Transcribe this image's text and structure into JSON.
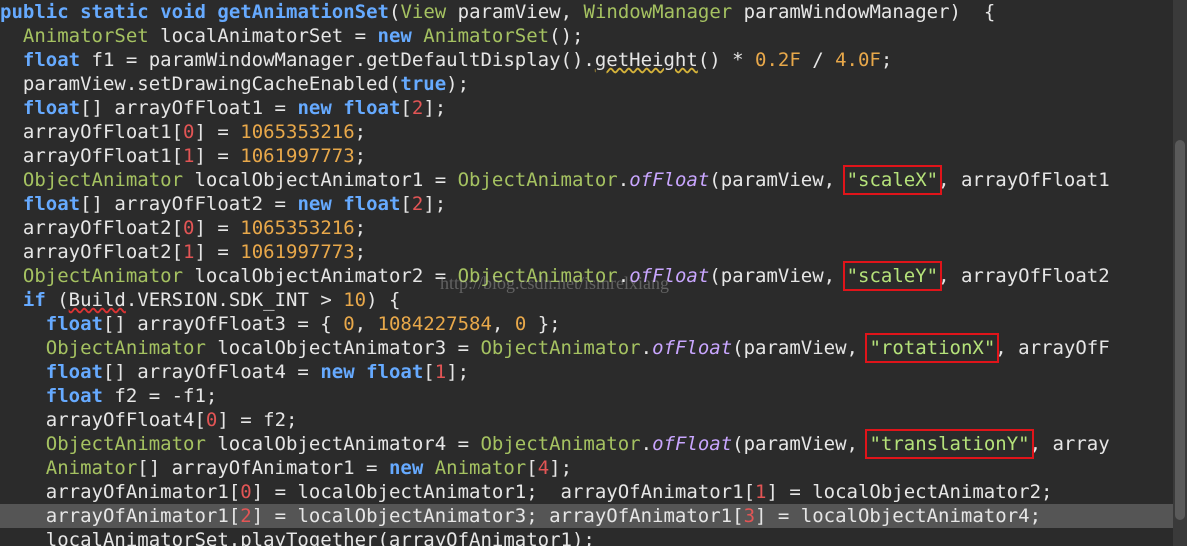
{
  "editor": {
    "lines": [
      {
        "indent": "",
        "tokens": [
          [
            "public",
            "kw2"
          ],
          [
            " ",
            "op"
          ],
          [
            "static",
            "kw2"
          ],
          [
            " ",
            "op"
          ],
          [
            "void",
            "kw2"
          ],
          [
            " ",
            "op"
          ],
          [
            "getAnimationSet",
            "kw2"
          ],
          [
            "(",
            "op"
          ],
          [
            "View",
            "cls"
          ],
          [
            " paramView, ",
            "ident"
          ],
          [
            "WindowManager",
            "cls"
          ],
          [
            " paramWindowManager)  {",
            "ident"
          ]
        ]
      },
      {
        "indent": "  ",
        "tokens": [
          [
            "AnimatorSet",
            "cls"
          ],
          [
            " localAnimatorSet = ",
            "ident"
          ],
          [
            "new",
            "kw2"
          ],
          [
            " ",
            "op"
          ],
          [
            "AnimatorSet",
            "cls"
          ],
          [
            "();",
            "op"
          ]
        ]
      },
      {
        "indent": "  ",
        "tokens": [
          [
            "float",
            "kw2"
          ],
          [
            " f1 = paramWindowManager.getDefaultDisplay().",
            "ident"
          ],
          [
            "getHeight",
            "warn"
          ],
          [
            "() * ",
            "ident"
          ],
          [
            "0.2F",
            "num"
          ],
          [
            " / ",
            "op"
          ],
          [
            "4.0F",
            "num"
          ],
          [
            ";",
            "op"
          ]
        ]
      },
      {
        "indent": "  ",
        "tokens": [
          [
            "paramView.setDrawingCacheEnabled(",
            "ident"
          ],
          [
            "true",
            "kw2"
          ],
          [
            ");",
            "op"
          ]
        ]
      },
      {
        "indent": "  ",
        "tokens": [
          [
            "float",
            "kw2"
          ],
          [
            "[] arrayOfFloat1 = ",
            "ident"
          ],
          [
            "new",
            "kw2"
          ],
          [
            " ",
            "op"
          ],
          [
            "float",
            "kw2"
          ],
          [
            "[",
            "op"
          ],
          [
            "2",
            "idx"
          ],
          [
            "];",
            "op"
          ]
        ]
      },
      {
        "indent": "  ",
        "tokens": [
          [
            "arrayOfFloat1[",
            "ident"
          ],
          [
            "0",
            "idx"
          ],
          [
            "] = ",
            "ident"
          ],
          [
            "1065353216",
            "num"
          ],
          [
            ";",
            "op"
          ]
        ]
      },
      {
        "indent": "  ",
        "tokens": [
          [
            "arrayOfFloat1[",
            "ident"
          ],
          [
            "1",
            "idx"
          ],
          [
            "] = ",
            "ident"
          ],
          [
            "1061997773",
            "num"
          ],
          [
            ";",
            "op"
          ]
        ]
      },
      {
        "indent": "  ",
        "tokens": [
          [
            "ObjectAnimator",
            "cls"
          ],
          [
            " localObjectAnimator1 = ",
            "ident"
          ],
          [
            "ObjectAnimator",
            "cls"
          ],
          [
            ".",
            "op"
          ],
          [
            "ofFloat",
            "italic"
          ],
          [
            "(paramView, ",
            "ident"
          ],
          [
            "\"scaleX\"",
            "str-box"
          ],
          [
            ", arrayOfFloat1",
            "ident"
          ]
        ]
      },
      {
        "indent": "  ",
        "tokens": [
          [
            "float",
            "kw2"
          ],
          [
            "[] arrayOfFloat2 = ",
            "ident"
          ],
          [
            "new",
            "kw2"
          ],
          [
            " ",
            "op"
          ],
          [
            "float",
            "kw2"
          ],
          [
            "[",
            "op"
          ],
          [
            "2",
            "idx"
          ],
          [
            "];",
            "op"
          ]
        ]
      },
      {
        "indent": "  ",
        "tokens": [
          [
            "arrayOfFloat2[",
            "ident"
          ],
          [
            "0",
            "idx"
          ],
          [
            "] = ",
            "ident"
          ],
          [
            "1065353216",
            "num"
          ],
          [
            ";",
            "op"
          ]
        ]
      },
      {
        "indent": "  ",
        "tokens": [
          [
            "arrayOfFloat2[",
            "ident"
          ],
          [
            "1",
            "idx"
          ],
          [
            "] = ",
            "ident"
          ],
          [
            "1061997773",
            "num"
          ],
          [
            ";",
            "op"
          ]
        ]
      },
      {
        "indent": "  ",
        "tokens": [
          [
            "ObjectAnimator",
            "cls"
          ],
          [
            " localObjectAnimator2 = ",
            "ident"
          ],
          [
            "ObjectAnimator",
            "cls"
          ],
          [
            ".",
            "op"
          ],
          [
            "ofFloat",
            "italic"
          ],
          [
            "(paramView, ",
            "ident"
          ],
          [
            "\"scaleY\"",
            "str-box"
          ],
          [
            ", arrayOfFloat2",
            "ident"
          ]
        ]
      },
      {
        "indent": "  ",
        "tokens": [
          [
            "if",
            "kw2"
          ],
          [
            " (",
            "op"
          ],
          [
            "Build",
            "err"
          ],
          [
            ".VERSION.SDK_INT > ",
            "ident"
          ],
          [
            "10",
            "num"
          ],
          [
            ") {",
            "op"
          ]
        ]
      },
      {
        "indent": "    ",
        "tokens": [
          [
            "float",
            "kw2"
          ],
          [
            "[] arrayOfFloat3 = { ",
            "ident"
          ],
          [
            "0",
            "num"
          ],
          [
            ", ",
            "op"
          ],
          [
            "1084227584",
            "num"
          ],
          [
            ", ",
            "op"
          ],
          [
            "0",
            "num"
          ],
          [
            " };",
            "op"
          ]
        ]
      },
      {
        "indent": "    ",
        "tokens": [
          [
            "ObjectAnimator",
            "cls"
          ],
          [
            " localObjectAnimator3 = ",
            "ident"
          ],
          [
            "ObjectAnimator",
            "cls"
          ],
          [
            ".",
            "op"
          ],
          [
            "ofFloat",
            "italic"
          ],
          [
            "(paramView, ",
            "ident"
          ],
          [
            "\"rotationX\"",
            "str-box"
          ],
          [
            ", arrayOfF",
            "ident"
          ]
        ]
      },
      {
        "indent": "    ",
        "tokens": [
          [
            "float",
            "kw2"
          ],
          [
            "[] arrayOfFloat4 = ",
            "ident"
          ],
          [
            "new",
            "kw2"
          ],
          [
            " ",
            "op"
          ],
          [
            "float",
            "kw2"
          ],
          [
            "[",
            "op"
          ],
          [
            "1",
            "idx"
          ],
          [
            "];",
            "op"
          ]
        ]
      },
      {
        "indent": "    ",
        "tokens": [
          [
            "float",
            "kw2"
          ],
          [
            " f2 = -f1;",
            "ident"
          ]
        ]
      },
      {
        "indent": "    ",
        "tokens": [
          [
            "arrayOfFloat4[",
            "ident"
          ],
          [
            "0",
            "idx"
          ],
          [
            "] = f2;",
            "ident"
          ]
        ]
      },
      {
        "indent": "    ",
        "tokens": [
          [
            "ObjectAnimator",
            "cls"
          ],
          [
            " localObjectAnimator4 = ",
            "ident"
          ],
          [
            "ObjectAnimator",
            "cls"
          ],
          [
            ".",
            "op"
          ],
          [
            "ofFloat",
            "italic"
          ],
          [
            "(paramView, ",
            "ident"
          ],
          [
            "\"translationY\"",
            "str-box"
          ],
          [
            ", array",
            "ident"
          ]
        ]
      },
      {
        "indent": "    ",
        "tokens": [
          [
            "Animator",
            "cls"
          ],
          [
            "[] arrayOfAnimator1 = ",
            "ident"
          ],
          [
            "new",
            "kw2"
          ],
          [
            " ",
            "op"
          ],
          [
            "Animator",
            "cls"
          ],
          [
            "[",
            "op"
          ],
          [
            "4",
            "idx"
          ],
          [
            "];",
            "op"
          ]
        ]
      },
      {
        "indent": "    ",
        "tokens": [
          [
            "arrayOfAnimator1[",
            "ident"
          ],
          [
            "0",
            "idx"
          ],
          [
            "] = localObjectAnimator1;  arrayOfAnimator1[",
            "ident"
          ],
          [
            "1",
            "idx"
          ],
          [
            "] = localObjectAnimator2;",
            "ident"
          ]
        ]
      },
      {
        "indent": "    ",
        "current": true,
        "tokens": [
          [
            "arrayOfAnimator1[",
            "ident"
          ],
          [
            "2",
            "idx"
          ],
          [
            "] = localObjectAnimator3; arrayOfAnimator1[",
            "ident"
          ],
          [
            "3",
            "idx"
          ],
          [
            "] = localObjectAnimator4;",
            "ident"
          ]
        ]
      },
      {
        "indent": "    ",
        "tokens": [
          [
            "localAnimatorSet.playTogether(arrayOfAnimator1);",
            "ident"
          ]
        ]
      }
    ]
  },
  "watermark": "http://blog.csdn.net/ismrelxiang",
  "colors": {
    "background": "#2b2b2b",
    "keyword": "#66aaff",
    "class": "#a5c261",
    "number": "#e8a84a",
    "string": "#b5e27a",
    "index": "#e25555",
    "highlight_box": "#e0141a",
    "current_line": "#555555"
  }
}
